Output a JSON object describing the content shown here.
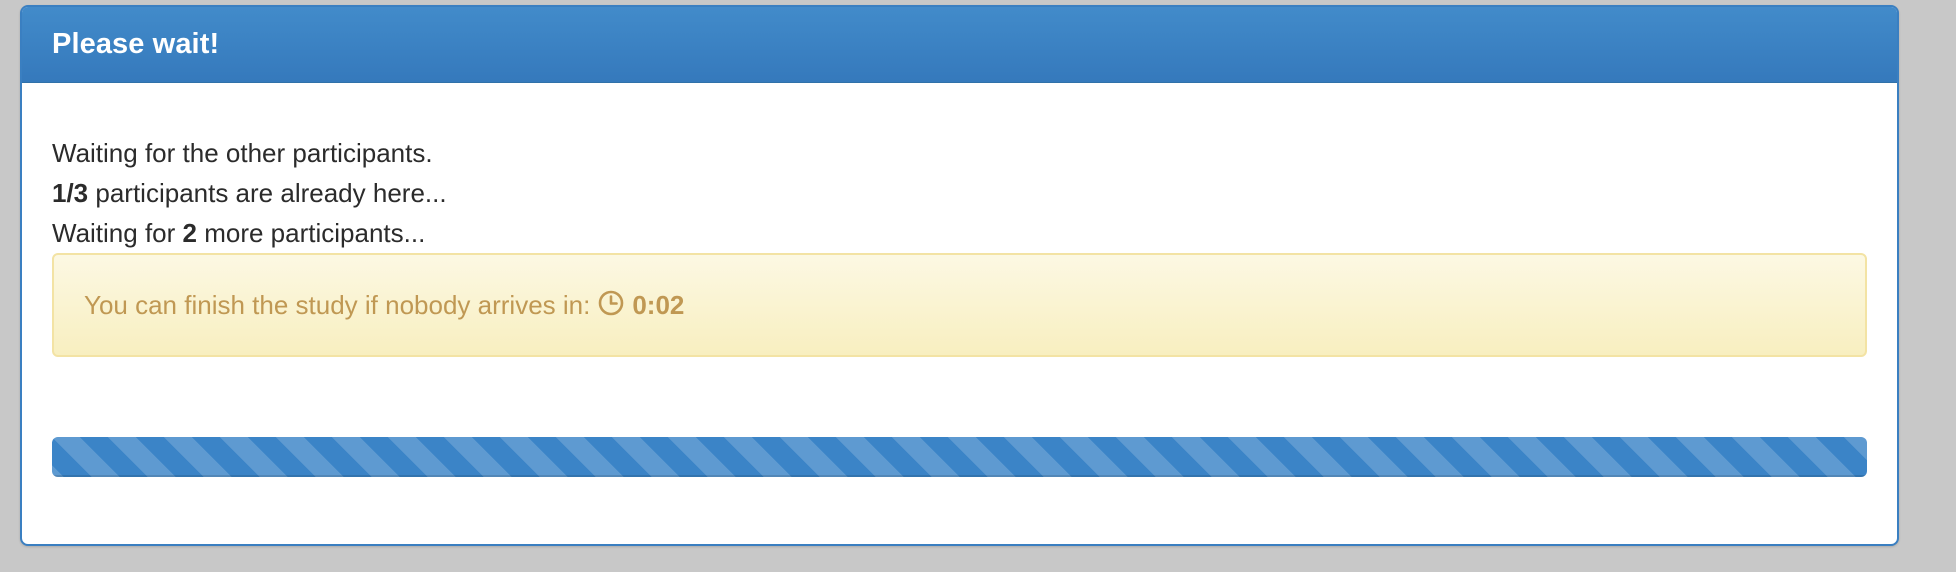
{
  "panel": {
    "title": "Please wait!"
  },
  "status": {
    "waiting_text": "Waiting for the other participants.",
    "present_count": "1/3",
    "present_suffix": " participants are already here...",
    "more_prefix": "Waiting for ",
    "more_count": "2",
    "more_suffix": " more participants..."
  },
  "alert": {
    "text": "You can finish the study if nobody arrives in:",
    "icon": "clock-icon",
    "timer": "0:02"
  },
  "progress": {
    "value_percent": 100,
    "style": "striped"
  },
  "colors": {
    "heading": "#3a84c8",
    "alert_background": "#fcf8e3",
    "alert_text": "#c09853",
    "progress": "#3b84c7"
  }
}
